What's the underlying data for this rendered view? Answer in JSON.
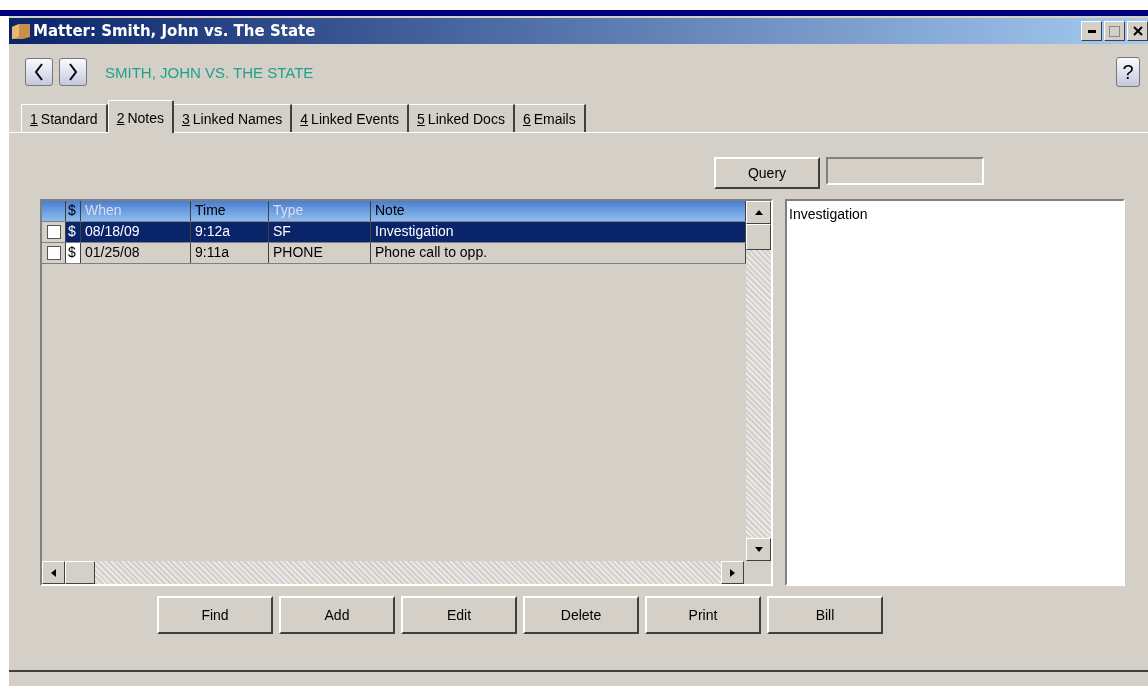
{
  "window": {
    "title": "Matter: Smith, John vs. The State"
  },
  "header": {
    "matter_name": "SMITH, JOHN VS. THE STATE",
    "help": "?"
  },
  "tabs": [
    {
      "key": "1",
      "label": "Standard",
      "selected": false
    },
    {
      "key": "2",
      "label": "Notes",
      "selected": true
    },
    {
      "key": "3",
      "label": "Linked Names",
      "selected": false
    },
    {
      "key": "4",
      "label": "Linked Events",
      "selected": false
    },
    {
      "key": "5",
      "label": "Linked Docs",
      "selected": false
    },
    {
      "key": "6",
      "label": "Emails",
      "selected": false
    }
  ],
  "query": {
    "button": "Query"
  },
  "table": {
    "columns": [
      "$",
      "When",
      "Time",
      "Type",
      "Note"
    ],
    "rows": [
      {
        "checked": false,
        "selected": true,
        "cells": [
          "$",
          "08/18/09",
          "9:12a",
          "SF",
          "Investigation"
        ]
      },
      {
        "checked": false,
        "selected": false,
        "cells": [
          "$",
          "01/25/08",
          "9:11a",
          "PHONE",
          "Phone call to opp."
        ]
      }
    ]
  },
  "preview": {
    "text": "Investigation"
  },
  "buttons": [
    "Find",
    "Add",
    "Edit",
    "Delete",
    "Print",
    "Bill"
  ]
}
